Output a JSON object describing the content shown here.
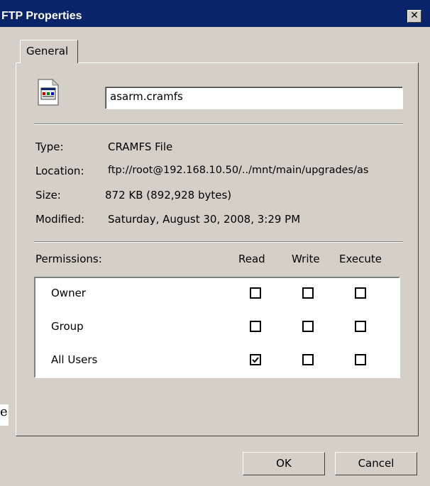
{
  "window": {
    "title": "FTP Properties",
    "close_label": "✕"
  },
  "tabs": [
    {
      "label": "General"
    }
  ],
  "file": {
    "name": "asarm.cramfs",
    "icon": "cramfs-file-icon"
  },
  "info": {
    "type_label": "Type:",
    "type_value": "CRAMFS File",
    "location_label": "Location:",
    "location_value": "ftp://root@192.168.10.50/../mnt/main/upgrades/as",
    "size_label": "Size:",
    "size_value": "872 KB (892,928 bytes)",
    "modified_label": "Modified:",
    "modified_value": "Saturday, August 30, 2008, 3:29 PM"
  },
  "permissions": {
    "label": "Permissions:",
    "columns": [
      "Read",
      "Write",
      "Execute"
    ],
    "rows": [
      {
        "name": "Owner",
        "read": false,
        "write": false,
        "execute": false
      },
      {
        "name": "Group",
        "read": false,
        "write": false,
        "execute": false
      },
      {
        "name": "All Users",
        "read": true,
        "write": false,
        "execute": false
      }
    ]
  },
  "buttons": {
    "ok": "OK",
    "cancel": "Cancel"
  },
  "stray_glyph": "e"
}
